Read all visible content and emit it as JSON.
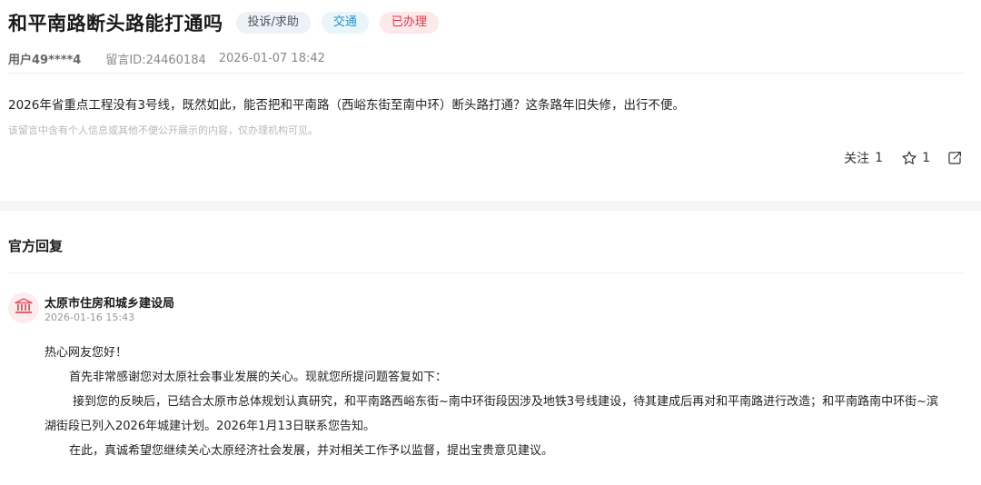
{
  "post": {
    "title": "和平南路断头路能打通吗",
    "tags": {
      "type": "投诉/求助",
      "category": "交通",
      "status": "已办理"
    },
    "user": "用户49****4",
    "message_id": "留言ID:24460184",
    "time": "2026-01-07 18:42",
    "content": "2026年省重点工程没有3号线，既然如此，能否把和平南路（西峪东街至南中环）断头路打通？这条路年旧失修，出行不便。",
    "notice": "该留言中含有个人信息或其他不便公开展示的内容，仅办理机构可见。"
  },
  "actions": {
    "follow_label": "关注",
    "follow_count": "1",
    "star_count": "1",
    "icons": {
      "star": "star-icon",
      "share": "share-icon"
    }
  },
  "official": {
    "section_title": "官方回复",
    "org_name": "太原市住房和城乡建设局",
    "reply_time": "2026-01-16 15:43",
    "avatar_icon": "government-building-icon",
    "paragraphs": [
      "热心网友您好！",
      "首先非常感谢您对太原社会事业发展的关心。现就您所提问题答复如下：",
      "接到您的反映后，已结合太原市总体规划认真研究，和平南路西峪东街~南中环街段因涉及地铁3号线建设，待其建成后再对和平南路进行改造；和平南路南中环街~滨",
      "湖街段已列入2026年城建计划。2026年1月13日联系您告知。",
      "在此，真诚希望您继续关心太原经济社会发展，并对相关工作予以监督，提出宝贵意见建议。"
    ]
  },
  "colors": {
    "tag_status": "#e0374a",
    "tag_category": "#2a8fc2",
    "avatar": "#d9535f"
  }
}
